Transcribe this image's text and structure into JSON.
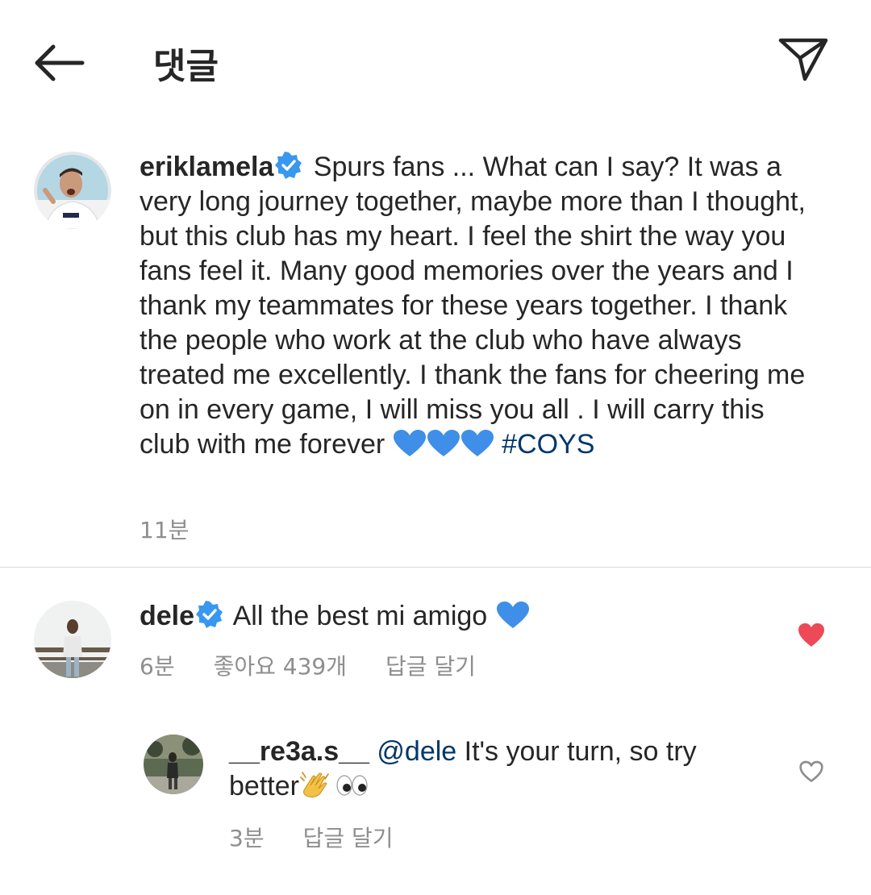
{
  "header": {
    "title": "댓글",
    "back_icon": "arrow-left-icon",
    "share_icon": "paper-plane-icon"
  },
  "caption": {
    "username": "eriklamela",
    "verified": true,
    "text": " Spurs fans ... What can I say? It was a very long journey together, maybe more than I thought, but this club has my heart. I feel the shirt the way you fans feel it. Many good memories over the years and I thank my teammates for these years together. I thank the people who work at the club who have always treated me excellently. I thank the fans for cheering me on in every game, I will miss you all . I will carry this club with me forever ",
    "emoji": "💙💙💙",
    "hashtag": "#COYS",
    "time": "11분"
  },
  "comment": {
    "username": "dele",
    "verified": true,
    "text": " All the best mi amigo ",
    "emoji": "💙",
    "time": "6분",
    "likes": "좋아요 439개",
    "reply_label": "답글 달기",
    "liked": true,
    "heart_color": "#ed4956"
  },
  "reply": {
    "username": "__re3a.s__",
    "mention": "@dele",
    "text": " It's your turn, so try better",
    "emoji": "👏👀",
    "time": "3분",
    "reply_label": "답글 달기",
    "liked": false
  },
  "colors": {
    "verified_blue": "#3897f0",
    "link_blue": "#00376b",
    "meta_gray": "#8e8e8e",
    "heart_blue": "#3f8fe8"
  }
}
